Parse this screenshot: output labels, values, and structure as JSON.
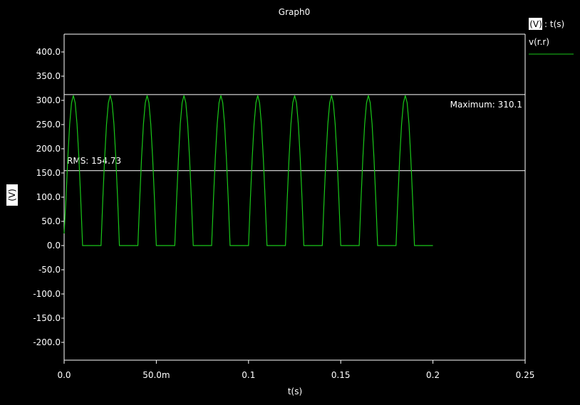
{
  "chart_data": {
    "type": "line",
    "title": "Graph0",
    "xlabel": "t(s)",
    "ylabel": "(V)",
    "xlim": [
      0,
      0.25
    ],
    "ylim": [
      -250,
      425
    ],
    "x_ticks": [
      0,
      0.05,
      0.1,
      0.15,
      0.2,
      0.25
    ],
    "x_tick_labels": [
      "0.0",
      "50.0m",
      "0.1",
      "0.15",
      "0.2",
      "0.25"
    ],
    "y_ticks": [
      400,
      350,
      300,
      250,
      200,
      150,
      100,
      50,
      0,
      -50,
      -100,
      -150,
      -200
    ],
    "y_tick_labels": [
      "400.0",
      "350.0",
      "300.0",
      "250.0",
      "200.0",
      "150.0",
      "100.0",
      "50.0",
      "0.0",
      "-50.0",
      "-100.0",
      "-150.0",
      "-200.0"
    ],
    "legend": {
      "axis_unit": "(V)",
      "axis_var": ": t(s)",
      "placement": "top-right"
    },
    "series": [
      {
        "name": "v(r.r)",
        "color": "#19c819",
        "x": [
          0.0,
          0.001,
          0.002,
          0.003,
          0.004,
          0.005,
          0.006,
          0.007,
          0.008,
          0.009,
          0.01,
          0.02,
          0.021,
          0.022,
          0.023,
          0.024,
          0.025,
          0.026,
          0.027,
          0.028,
          0.029,
          0.03,
          0.04,
          0.041,
          0.042,
          0.043,
          0.044,
          0.045,
          0.046,
          0.047,
          0.048,
          0.049,
          0.05,
          0.06,
          0.061,
          0.062,
          0.063,
          0.064,
          0.065,
          0.066,
          0.067,
          0.068,
          0.069,
          0.07,
          0.08,
          0.081,
          0.082,
          0.083,
          0.084,
          0.085,
          0.086,
          0.087,
          0.088,
          0.089,
          0.09,
          0.1,
          0.101,
          0.102,
          0.103,
          0.104,
          0.105,
          0.106,
          0.107,
          0.108,
          0.109,
          0.11,
          0.12,
          0.121,
          0.122,
          0.123,
          0.124,
          0.125,
          0.126,
          0.127,
          0.128,
          0.129,
          0.13,
          0.14,
          0.141,
          0.142,
          0.143,
          0.144,
          0.145,
          0.146,
          0.147,
          0.148,
          0.149,
          0.15,
          0.16,
          0.161,
          0.162,
          0.163,
          0.164,
          0.165,
          0.166,
          0.167,
          0.168,
          0.169,
          0.17,
          0.18,
          0.181,
          0.182,
          0.183,
          0.184,
          0.185,
          0.186,
          0.187,
          0.188,
          0.189,
          0.19,
          0.2
        ],
        "y": [
          25,
          96,
          182,
          251,
          295,
          310,
          295,
          251,
          182,
          96,
          0,
          0,
          96,
          182,
          251,
          295,
          310,
          295,
          251,
          182,
          96,
          0,
          0,
          96,
          182,
          251,
          295,
          310,
          295,
          251,
          182,
          96,
          0,
          0,
          96,
          182,
          251,
          295,
          310,
          295,
          251,
          182,
          96,
          0,
          0,
          96,
          182,
          251,
          295,
          310,
          295,
          251,
          182,
          96,
          0,
          0,
          96,
          182,
          251,
          295,
          310,
          295,
          251,
          182,
          96,
          0,
          0,
          96,
          182,
          251,
          295,
          310,
          295,
          251,
          182,
          96,
          0,
          0,
          96,
          182,
          251,
          295,
          310,
          295,
          251,
          182,
          96,
          0,
          0,
          96,
          182,
          251,
          295,
          310,
          295,
          251,
          182,
          96,
          0,
          0,
          96,
          182,
          251,
          295,
          310,
          295,
          251,
          182,
          96,
          0,
          0
        ]
      }
    ],
    "annotations": [
      {
        "label": "Maximum: 310.1",
        "y": 312
      },
      {
        "label": "RMS: 154.73",
        "y": 154.73
      }
    ]
  }
}
